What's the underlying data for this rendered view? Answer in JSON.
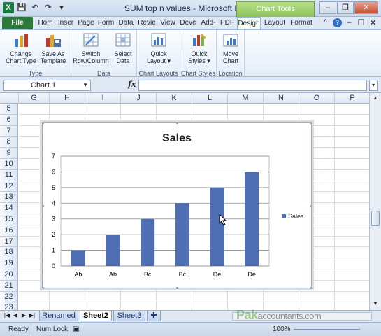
{
  "window": {
    "title": "SUM top n values  -  Microsoft Excel",
    "context_tab": "Chart Tools"
  },
  "tabs": [
    {
      "label": "File"
    },
    {
      "label": "Hom"
    },
    {
      "label": "Inser"
    },
    {
      "label": "Page"
    },
    {
      "label": "Form"
    },
    {
      "label": "Data"
    },
    {
      "label": "Revie"
    },
    {
      "label": "View"
    },
    {
      "label": "Deve"
    },
    {
      "label": "Add-"
    },
    {
      "label": "PDF"
    },
    {
      "label": "Design"
    },
    {
      "label": "Layout"
    },
    {
      "label": "Format"
    }
  ],
  "ribbon": {
    "groups": [
      {
        "label": "Type",
        "buttons": [
          "Change\nChart Type",
          "Save As\nTemplate"
        ]
      },
      {
        "label": "Data",
        "buttons": [
          "Switch\nRow/Column",
          "Select\nData"
        ]
      },
      {
        "label": "Chart Layouts",
        "buttons": [
          "Quick\nLayout ▾"
        ]
      },
      {
        "label": "Chart Styles",
        "buttons": [
          "Quick\nStyles ▾"
        ]
      },
      {
        "label": "Location",
        "buttons": [
          "Move\nChart"
        ]
      }
    ]
  },
  "formula_bar": {
    "name_box": "Chart 1",
    "fx": "fx",
    "value": ""
  },
  "columns": [
    "G",
    "H",
    "I",
    "J",
    "K",
    "L",
    "M",
    "N",
    "O",
    "P"
  ],
  "rows": [
    "5",
    "6",
    "7",
    "8",
    "9",
    "10",
    "11",
    "12",
    "13",
    "14",
    "15",
    "16",
    "17",
    "18",
    "19",
    "20",
    "21",
    "22",
    "23"
  ],
  "chart_data": {
    "type": "bar",
    "title": "Sales",
    "categories": [
      "Ab",
      "Ab",
      "Bc",
      "Bc",
      "De",
      "De"
    ],
    "series": [
      {
        "name": "Sales",
        "values": [
          1,
          2,
          3,
          4,
          5,
          6
        ],
        "color": "#4f6fb5"
      }
    ],
    "ylim": [
      0,
      7
    ],
    "yticks": [
      "0",
      "1",
      "2",
      "3",
      "4",
      "5",
      "6",
      "7"
    ],
    "grid": true,
    "legend": "right"
  },
  "sheets": [
    {
      "label": "Renamed"
    },
    {
      "label": "Sheet2"
    },
    {
      "label": "Sheet3"
    }
  ],
  "status": {
    "ready": "Ready",
    "num_lock": "Num Lock",
    "zoom": "100%"
  },
  "watermark": {
    "brand": "Pak",
    "site": "accountants.com"
  }
}
